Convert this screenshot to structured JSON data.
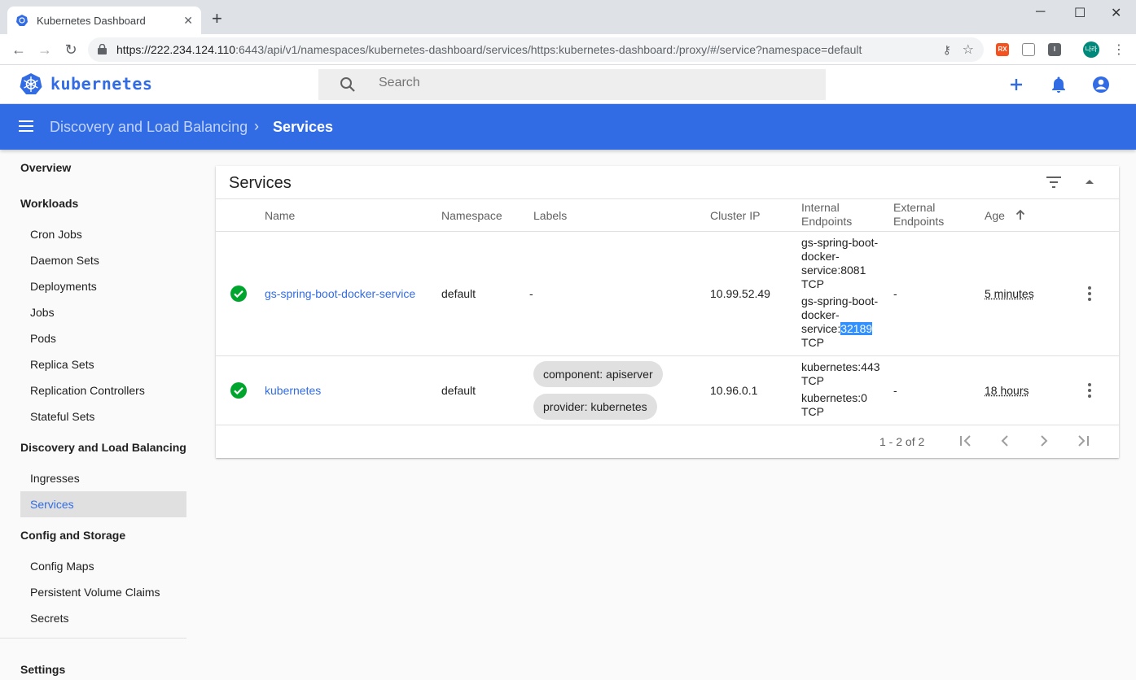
{
  "browser": {
    "tab_title": "Kubernetes Dashboard",
    "url_host": "https://222.234.124.110",
    "url_rest": ":6443/api/v1/namespaces/kubernetes-dashboard/services/https:kubernetes-dashboard:/proxy/#/service?namespace=default",
    "profile_label": "나라"
  },
  "header": {
    "brand": "kubernetes",
    "search_placeholder": "Search"
  },
  "toolbar": {
    "breadcrumb_parent": "Discovery and Load Balancing",
    "breadcrumb_current": "Services"
  },
  "sidebar": {
    "overview": "Overview",
    "workloads": "Workloads",
    "cron_jobs": "Cron Jobs",
    "daemon_sets": "Daemon Sets",
    "deployments": "Deployments",
    "jobs": "Jobs",
    "pods": "Pods",
    "replica_sets": "Replica Sets",
    "replication_controllers": "Replication Controllers",
    "stateful_sets": "Stateful Sets",
    "discovery": "Discovery and Load Balancing",
    "ingresses": "Ingresses",
    "services": "Services",
    "config_storage": "Config and Storage",
    "config_maps": "Config Maps",
    "pvc": "Persistent Volume Claims",
    "secrets": "Secrets",
    "settings": "Settings"
  },
  "card": {
    "title": "Services",
    "columns": {
      "name": "Name",
      "namespace": "Namespace",
      "labels": "Labels",
      "cluster_ip": "Cluster IP",
      "internal_1": "Internal",
      "internal_2": "Endpoints",
      "external_1": "External",
      "external_2": "Endpoints",
      "age": "Age"
    },
    "rows": [
      {
        "name": "gs-spring-boot-docker-service",
        "namespace": "default",
        "labels_text": "-",
        "cluster_ip": "10.99.52.49",
        "ep1_l1": "gs-spring-boot-",
        "ep1_l2": "docker-",
        "ep1_l3": "service:8081",
        "ep1_l4": "TCP",
        "ep2_l1": "gs-spring-boot-",
        "ep2_l2": "docker-",
        "ep2_l3a": "service:",
        "ep2_l3b": "32189",
        "ep2_l4": "TCP",
        "external": "-",
        "age": "5 minutes"
      },
      {
        "name": "kubernetes",
        "namespace": "default",
        "label1": "component: apiserver",
        "label2": "provider: kubernetes",
        "cluster_ip": "10.96.0.1",
        "ep1_l1": "kubernetes:443",
        "ep1_l2": "TCP",
        "ep2_l1": "kubernetes:0",
        "ep2_l2": "TCP",
        "external": "-",
        "age": "18 hours"
      }
    ],
    "pagination": "1 - 2 of 2"
  },
  "colors": {
    "primary": "#326ce5",
    "success": "#00a52e"
  }
}
